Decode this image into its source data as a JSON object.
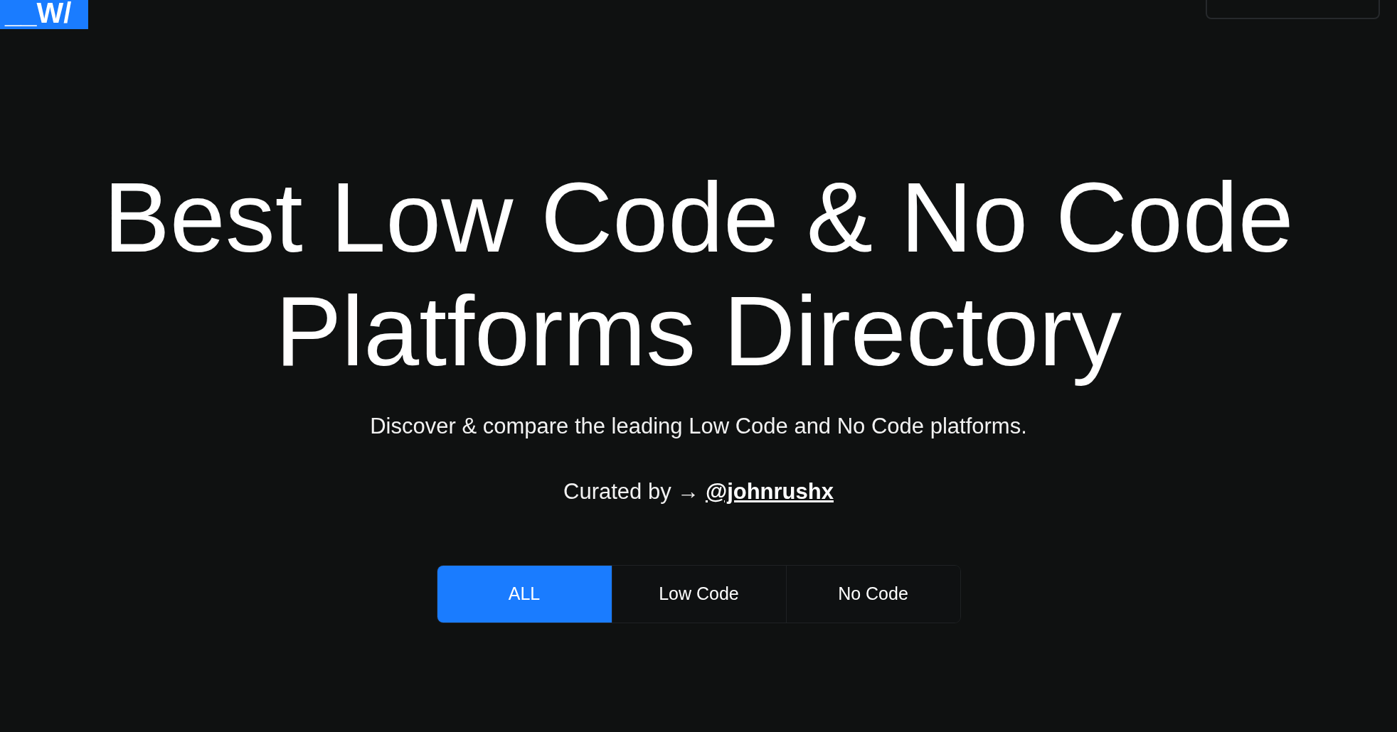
{
  "logo": {
    "text": "__W/"
  },
  "hero": {
    "title": "Best Low Code & No Code Platforms Directory",
    "subtitle": "Discover & compare the leading Low Code and No Code platforms.",
    "curated": {
      "label": "Curated by →",
      "link": "@johnrushx"
    }
  },
  "tabs": [
    {
      "label": "ALL",
      "selected": true
    },
    {
      "label": "Low Code",
      "selected": false
    },
    {
      "label": "No Code",
      "selected": false
    }
  ]
}
